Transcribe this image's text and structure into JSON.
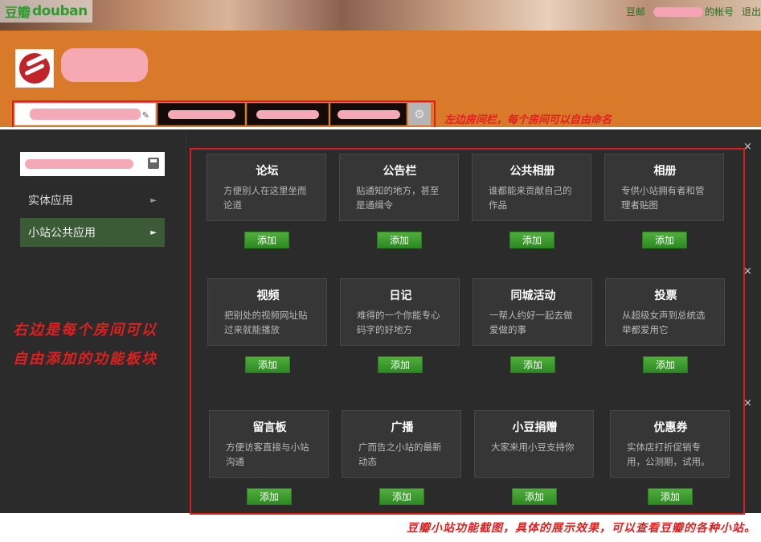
{
  "topbar": {
    "logo_cn": "豆瓣",
    "logo_en": "douban",
    "mail": "豆邮",
    "account_suffix": "的帐号",
    "logout": "退出"
  },
  "tabs_annotation": "左边房间栏，每个房间可以自由命名",
  "left_nav": [
    {
      "label": "实体应用",
      "arrow": "►"
    },
    {
      "label": "小站公共应用",
      "arrow": "►"
    }
  ],
  "left_annotation": {
    "line1": "右边是每个房间可以",
    "line2": "自由添加的功能板块"
  },
  "apps": [
    {
      "title": "论坛",
      "desc": "方便别人在这里坐而论道",
      "button": "添加"
    },
    {
      "title": "公告栏",
      "desc": "贴通知的地方，甚至是通缉令",
      "button": "添加"
    },
    {
      "title": "公共相册",
      "desc": "谁都能来贡献自己的作品",
      "button": "添加"
    },
    {
      "title": "相册",
      "desc": "专供小站拥有者和管理者贴图",
      "button": "添加"
    },
    {
      "title": "视频",
      "desc": "把别处的视频网址贴过来就能播放",
      "button": "添加"
    },
    {
      "title": "日记",
      "desc": "难得的一个你能专心码字的好地方",
      "button": "添加"
    },
    {
      "title": "同城活动",
      "desc": "一帮人约好一起去做爱做的事",
      "button": "添加"
    },
    {
      "title": "投票",
      "desc": "从超级女声到总统选举都爱用它",
      "button": "添加"
    },
    {
      "title": "留言板",
      "desc": "方便访客直接与小站沟通",
      "button": "添加"
    },
    {
      "title": "广播",
      "desc": "广而告之小站的最新动态",
      "button": "添加"
    },
    {
      "title": "小豆捐赠",
      "desc": "大家来用小豆支持你",
      "button": "添加"
    },
    {
      "title": "优惠券",
      "desc": "实体店打折促销专用，公测期，试用。",
      "button": "添加"
    }
  ],
  "close_glyph": "×",
  "footer_annotation": "豆瓣小站功能截图，具体的展示效果，可以查看豆瓣的各种小站。",
  "icons": {
    "edit": "pencil-icon",
    "gear": "gear-icon",
    "save": "save-icon"
  },
  "colors": {
    "header": "#d97a2a",
    "main": "#2b2b2b",
    "accent_green": "#2e9b2e",
    "annotation_red": "#dd1d1d"
  }
}
